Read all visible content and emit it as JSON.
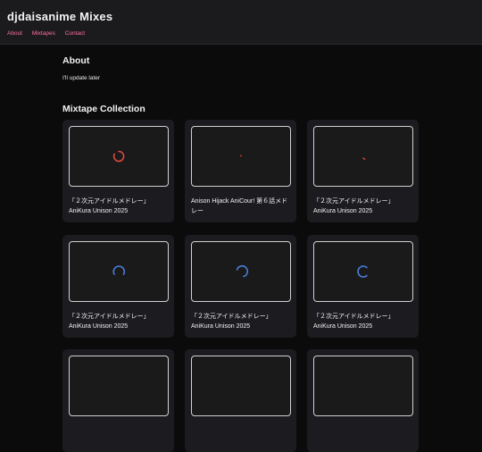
{
  "site": {
    "title": "djdaisanime Mixes"
  },
  "nav": {
    "items": [
      "About",
      "Mixtapes",
      "Contact"
    ]
  },
  "about": {
    "heading": "About",
    "text": "I'll update later"
  },
  "collection": {
    "heading": "Mixtape Collection",
    "cards": [
      {
        "title": "「２次元アイドルメドレー」",
        "subtitle": "AniKura Unison 2025",
        "spinner": "red-arc"
      },
      {
        "title": "Anison Hijack AniCour! 第６話メドレー",
        "subtitle": "",
        "spinner": "red-dot"
      },
      {
        "title": "「２次元アイドルメドレー」",
        "subtitle": "AniKura Unison 2025",
        "spinner": "red-dot"
      },
      {
        "title": "「２次元アイドルメドレー」",
        "subtitle": "AniKura Unison 2025",
        "spinner": "blue-arc"
      },
      {
        "title": "「２次元アイドルメドレー」",
        "subtitle": "AniKura Unison 2025",
        "spinner": "blue-arc"
      },
      {
        "title": "「２次元アイドルメドレー」",
        "subtitle": "AniKura Unison 2025",
        "spinner": "blue-arc"
      }
    ]
  },
  "colors": {
    "accent": "#ff6fa6",
    "spinner_red": "#e0493e",
    "spinner_blue": "#4a7ddb"
  }
}
